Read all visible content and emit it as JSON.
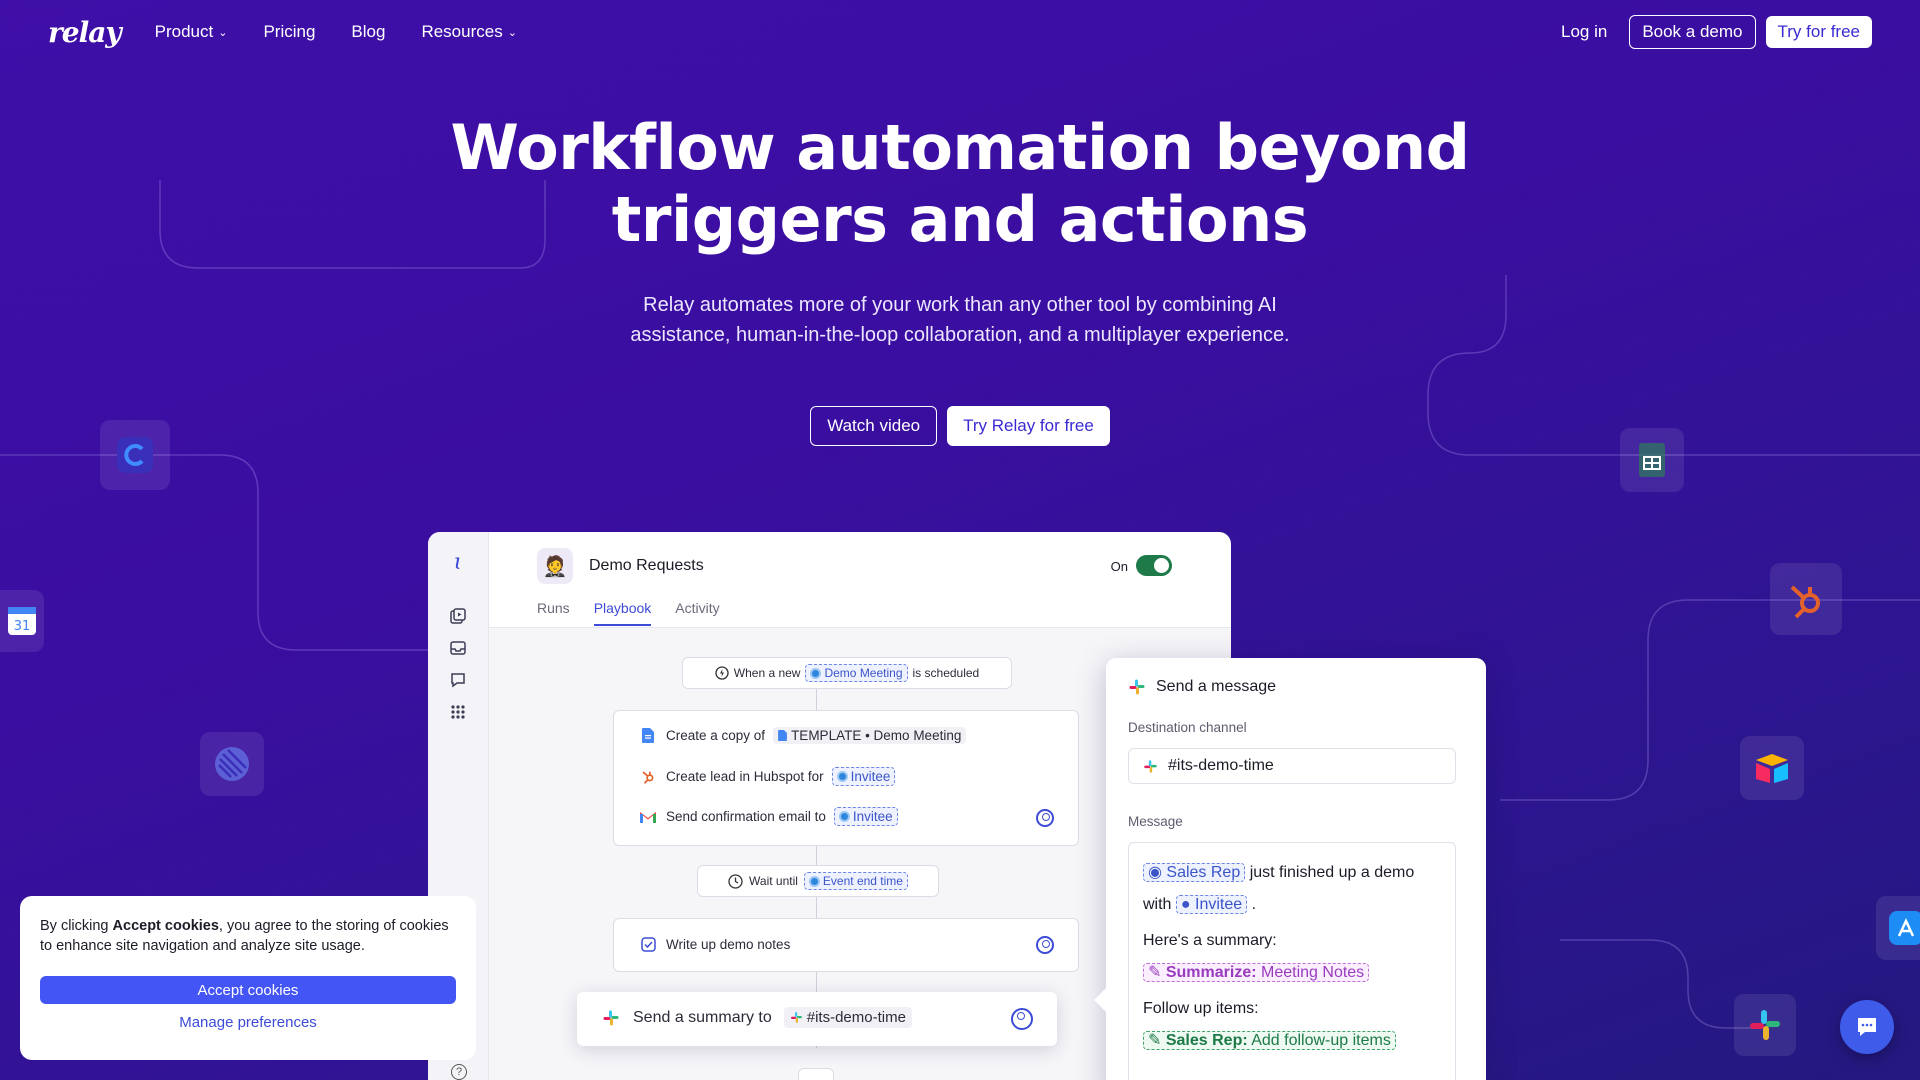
{
  "nav": {
    "logo": "relay",
    "items": [
      {
        "label": "Product",
        "has_dropdown": true
      },
      {
        "label": "Pricing",
        "has_dropdown": false
      },
      {
        "label": "Blog",
        "has_dropdown": false
      },
      {
        "label": "Resources",
        "has_dropdown": true
      }
    ],
    "login": "Log in",
    "book_demo": "Book a demo",
    "try_free": "Try for free"
  },
  "hero": {
    "title_line1": "Workflow automation beyond",
    "title_line2": "triggers and actions",
    "subtitle_line1": "Relay automates more of your work than any other tool by combining AI",
    "subtitle_line2": "assistance, human-in-the-loop collaboration, and a multiplayer experience.",
    "watch_video": "Watch video",
    "try_relay": "Try Relay for free"
  },
  "floating_icons": [
    "calendly-icon",
    "google-calendar-icon",
    "linear-icon",
    "google-sheets-icon",
    "hubspot-icon",
    "airtable-icon",
    "app-store-icon",
    "slack-icon"
  ],
  "app": {
    "workflow_name": "Demo Requests",
    "status_label": "On",
    "status_on": true,
    "tabs": [
      "Runs",
      "Playbook",
      "Activity"
    ],
    "active_tab": "Playbook",
    "trigger": {
      "prefix": "When a new",
      "chip": "Demo Meeting",
      "suffix": "is scheduled"
    },
    "steps": [
      {
        "icon": "google-docs-icon",
        "text": "Create a copy of",
        "chip": "TEMPLATE • Demo Meeting"
      },
      {
        "icon": "hubspot-icon",
        "text": "Create lead in Hubspot for",
        "chip": "Invitee"
      },
      {
        "icon": "gmail-icon",
        "text": "Send confirmation email to",
        "chip": "Invitee"
      }
    ],
    "wait": {
      "prefix": "Wait until",
      "chip": "Event end time"
    },
    "task": {
      "text": "Write up demo notes"
    },
    "summary": {
      "text": "Send a summary to",
      "channel": "#its-demo-time"
    }
  },
  "message_panel": {
    "title": "Send a message",
    "destination_label": "Destination channel",
    "destination_value": "#its-demo-time",
    "message_label": "Message",
    "sales_rep": "Sales Rep",
    "line1_rest": "just finished up a demo",
    "with": "with",
    "invitee": "Invitee",
    "period": ".",
    "summary_heading": "Here's a summary:",
    "summarize_label": "Summarize:",
    "summarize_value": "Meeting Notes",
    "followup_heading": "Follow up items:",
    "followup_label": "Sales Rep:",
    "followup_value": "Add follow-up items"
  },
  "cookie": {
    "text_prefix": "By clicking ",
    "text_bold": "Accept cookies",
    "text_suffix": ", you agree to the storing of cookies to enhance site navigation and analyze site usage.",
    "accept": "Accept cookies",
    "manage": "Manage preferences"
  },
  "colors": {
    "background": "#3a0ea0",
    "accent": "#3d4bd6",
    "toggle_on": "#1f7a4a"
  }
}
